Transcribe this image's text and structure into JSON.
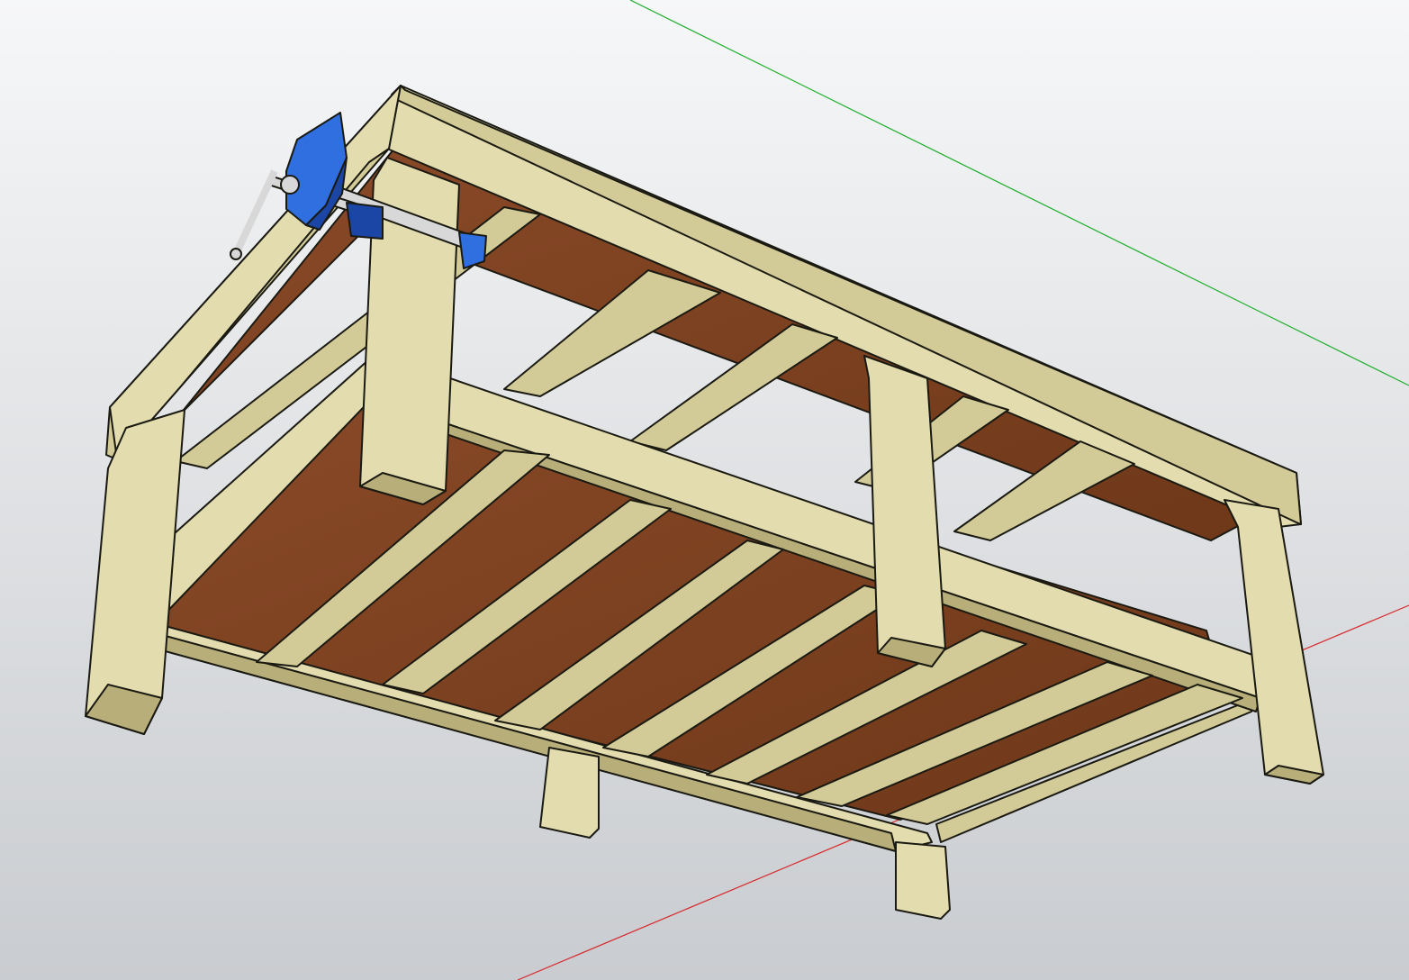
{
  "viewport": {
    "background_top": "#f6f7f8",
    "background_bottom": "#c9ccd0"
  },
  "axes": {
    "green_axis_color": "#1cae2c",
    "red_axis_color": "#d8282b"
  },
  "model": {
    "wood_light": "#e3dcaf",
    "wood_mid": "#d3cb97",
    "wood_dark": "#b7ae79",
    "edge_color": "#1a1a12",
    "plywood_color": "#8a4a28",
    "plywood_dark": "#6e3819",
    "vise_color": "#2f6fe0",
    "vise_dark": "#1b46a6",
    "steel_color": "#d8d8d8",
    "vise_icon": "bench-vise-icon"
  }
}
